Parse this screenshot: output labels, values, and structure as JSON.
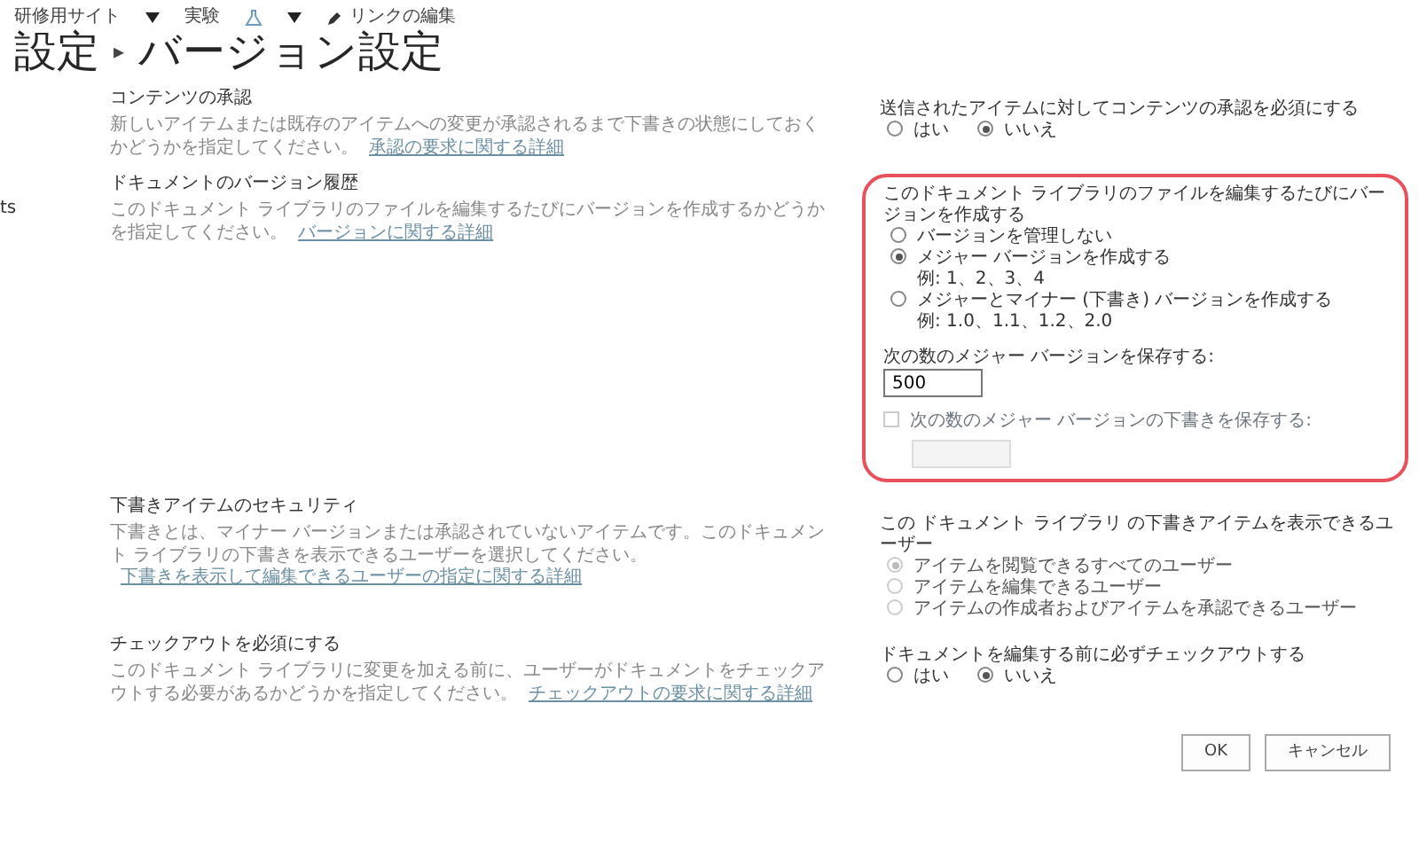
{
  "top_nav": {
    "site": "研修用サイト",
    "subsite": "実験",
    "edit_links": "リンクの編集"
  },
  "title": {
    "parent": "設定",
    "separator": "▸",
    "current": "バージョン設定"
  },
  "side_text": "ts",
  "sections": [
    {
      "title": "コンテンツの承認",
      "description": "新しいアイテムまたは既存のアイテムへの変更が承認されるまで下書きの状態にしておくかどうかを指定してください。",
      "link": "承認の要求に関する詳細",
      "highlighted": false,
      "question": "送信されたアイテムに対してコンテンツの承認を必須にする",
      "options": [
        {
          "label": "はい",
          "selected": false,
          "disabled": false
        },
        {
          "label": "いいえ",
          "selected": true,
          "disabled": false
        }
      ]
    },
    {
      "title": "ドキュメントのバージョン履歴",
      "description": "このドキュメント ライブラリのファイルを編集するたびにバージョンを作成するかどうかを指定してください。",
      "link": "バージョンに関する詳細",
      "highlighted": true,
      "question": "このドキュメント ライブラリのファイルを編集するたびにバージョンを作成する",
      "options": [
        {
          "label": "バージョンを管理しない",
          "selected": false,
          "disabled": false
        },
        {
          "label": "メジャー バージョンを作成する",
          "example": "例: 1、2、3、4",
          "selected": true,
          "disabled": false
        },
        {
          "label": "メジャーとマイナー (下書き) バージョンを作成する",
          "example": "例: 1.0、1.1、1.2、2.0",
          "selected": false,
          "disabled": false
        }
      ],
      "limits": [
        {
          "kind": "label",
          "label": "次の数のメジャー バージョンを保存する:",
          "value": "500",
          "disabled": false
        },
        {
          "kind": "checkbox",
          "label": "次の数のメジャー バージョンの下書きを保存する:",
          "checked": false,
          "disabled": true
        }
      ]
    },
    {
      "title": "下書きアイテムのセキュリティ",
      "description": "下書きとは、マイナー バージョンまたは承認されていないアイテムです。このドキュメント ライブラリの下書きを表示できるユーザーを選択してください。",
      "link": "下書きを表示して編集できるユーザーの指定に関する詳細",
      "highlighted": false,
      "question": "この ドキュメント ライブラリ の下書きアイテムを表示できるユーザー",
      "options": [
        {
          "label": "アイテムを閲覧できるすべてのユーザー",
          "selected": true,
          "disabled": true
        },
        {
          "label": "アイテムを編集できるユーザー",
          "selected": false,
          "disabled": true
        },
        {
          "label": "アイテムの作成者およびアイテムを承認できるユーザー",
          "selected": false,
          "disabled": true
        }
      ]
    },
    {
      "title": "チェックアウトを必須にする",
      "description": "このドキュメント ライブラリに変更を加える前に、ユーザーがドキュメントをチェックアウトする必要があるかどうかを指定してください。",
      "link": "チェックアウトの要求に関する詳細",
      "highlighted": false,
      "question": "ドキュメントを編集する前に必ずチェックアウトする",
      "options": [
        {
          "label": "はい",
          "selected": false,
          "disabled": false
        },
        {
          "label": "いいえ",
          "selected": true,
          "disabled": false
        }
      ]
    }
  ],
  "buttons": [
    "OK",
    "キャンセル"
  ]
}
